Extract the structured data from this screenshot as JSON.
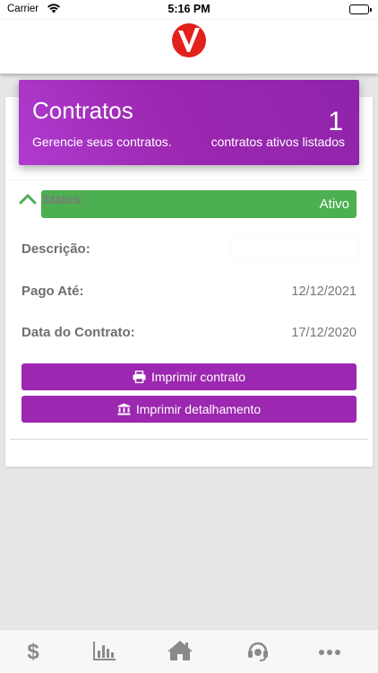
{
  "status_bar": {
    "carrier": "Carrier",
    "time": "5:16 PM"
  },
  "header": {
    "logo_icon": "red-v-logo-icon",
    "logo_color": "#e3201b"
  },
  "hero": {
    "title": "Contratos",
    "subtitle": "Gerencie seus contratos.",
    "count": "1",
    "count_label": "contratos ativos listados",
    "gradient_color": "#9c27b0"
  },
  "contract": {
    "status_label": "Status:",
    "status_value": "Ativo",
    "status_color": "#4caf50",
    "fields": [
      {
        "label": "Descrição:",
        "value": ""
      },
      {
        "label": "Pago Até:",
        "value": "12/12/2021"
      },
      {
        "label": "Data do Contrato:",
        "value": "17/12/2020"
      }
    ],
    "buttons": {
      "print_contract": "Imprimir contrato",
      "print_detail": "Imprimir detalhamento"
    }
  },
  "tab_bar": {
    "items": [
      {
        "icon": "dollar-icon",
        "label": "$"
      },
      {
        "icon": "bar-chart-icon"
      },
      {
        "icon": "home-icon"
      },
      {
        "icon": "headset-icon"
      },
      {
        "icon": "more-icon"
      }
    ]
  }
}
